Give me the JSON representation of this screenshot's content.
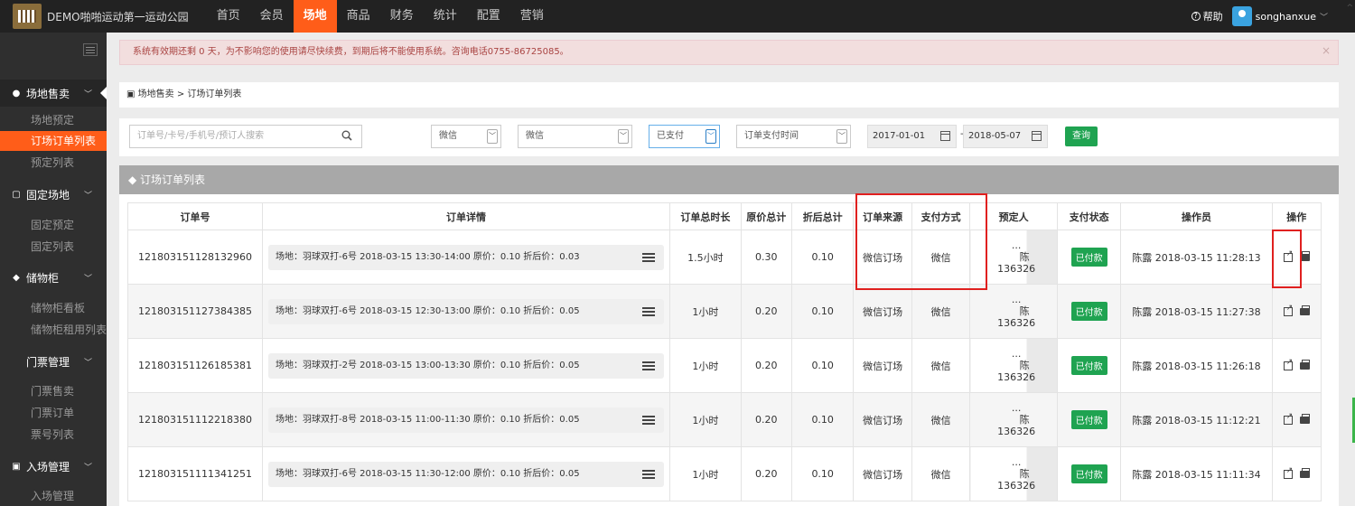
{
  "header": {
    "brand": "DEMO啪啪运动第一运动公园",
    "nav": [
      "首页",
      "会员",
      "场地",
      "商品",
      "财务",
      "统计",
      "配置",
      "营销"
    ],
    "active_nav": 2,
    "help_label": "帮助",
    "user": "songhanxue"
  },
  "sidebar": {
    "groups": [
      {
        "label": "场地售卖",
        "icon": "globe-icon",
        "items": [
          "场地预定",
          "订场订单列表",
          "预定列表"
        ]
      },
      {
        "label": "固定场地",
        "icon": "square-icon",
        "items": [
          "固定预定",
          "固定列表"
        ]
      },
      {
        "label": "储物柜",
        "icon": "cube-icon",
        "items": [
          "储物柜看板",
          "储物柜租用列表"
        ]
      },
      {
        "label": "门票管理",
        "icon": "",
        "items": [
          "门票售卖",
          "门票订单",
          "票号列表"
        ]
      },
      {
        "label": "入场管理",
        "icon": "card-icon",
        "items": [
          "入场管理"
        ]
      }
    ],
    "active_item": "订场订单列表"
  },
  "alert": {
    "text": "系统有效期还剩 0 天，为不影响您的使用请尽快续费，到期后将不能使用系统。咨询电话0755-86725085。"
  },
  "breadcrumb": "场地售卖 > 订场订单列表",
  "filters": {
    "search_placeholder": "订单号/卡号/手机号/预订人搜索",
    "source": "微信",
    "pay_method": "微信",
    "pay_status": "已支付",
    "time_type": "订单支付时间",
    "start_date": "2017-01-01",
    "date_sep": "-",
    "end_date": "2018-05-07",
    "query_label": "查询"
  },
  "panel_title": "订场订单列表",
  "table": {
    "headers": [
      "订单号",
      "订单详情",
      "订单总时长",
      "原价总计",
      "折后总计",
      "订单来源",
      "支付方式",
      "预定人",
      "支付状态",
      "操作员",
      "操作"
    ],
    "rows": [
      {
        "id": "121803151128132960",
        "detail": "场地：羽球双打-6号 2018-03-15 13:30-14:00   原价：0.10   折后价：0.03",
        "duration": "1.5小时",
        "orig": "0.30",
        "disc": "0.10",
        "source": "微信订场",
        "pay": "微信",
        "booker_a": "...",
        "booker_b": "陈",
        "booker_c": "136326",
        "status": "已付款",
        "operator": "陈露 2018-03-15 11:28:13"
      },
      {
        "id": "121803151127384385",
        "detail": "场地：羽球双打-6号 2018-03-15 12:30-13:00   原价：0.10   折后价：0.05",
        "duration": "1小时",
        "orig": "0.20",
        "disc": "0.10",
        "source": "微信订场",
        "pay": "微信",
        "booker_a": "...",
        "booker_b": "陈",
        "booker_c": "136326",
        "status": "已付款",
        "operator": "陈露 2018-03-15 11:27:38"
      },
      {
        "id": "121803151126185381",
        "detail": "场地：羽球双打-2号 2018-03-15 13:00-13:30   原价：0.10   折后价：0.05",
        "duration": "1小时",
        "orig": "0.20",
        "disc": "0.10",
        "source": "微信订场",
        "pay": "微信",
        "booker_a": "...",
        "booker_b": "陈",
        "booker_c": "136326",
        "status": "已付款",
        "operator": "陈露 2018-03-15 11:26:18"
      },
      {
        "id": "121803151112218380",
        "detail": "场地：羽球双打-8号 2018-03-15 11:00-11:30   原价：0.10   折后价：0.05",
        "duration": "1小时",
        "orig": "0.20",
        "disc": "0.10",
        "source": "微信订场",
        "pay": "微信",
        "booker_a": "...",
        "booker_b": "陈",
        "booker_c": "136326",
        "status": "已付款",
        "operator": "陈露 2018-03-15 11:12:21"
      },
      {
        "id": "121803151111341251",
        "detail": "场地：羽球双打-6号 2018-03-15 11:30-12:00   原价：0.10   折后价：0.05",
        "duration": "1小时",
        "orig": "0.20",
        "disc": "0.10",
        "source": "微信订场",
        "pay": "微信",
        "booker_a": "...",
        "booker_b": "陈",
        "booker_c": "136326",
        "status": "已付款",
        "operator": "陈露 2018-03-15 11:11:34"
      }
    ]
  },
  "colors": {
    "accent": "#ff5d19",
    "success": "#1fa351",
    "highlight": "#e0201f"
  }
}
